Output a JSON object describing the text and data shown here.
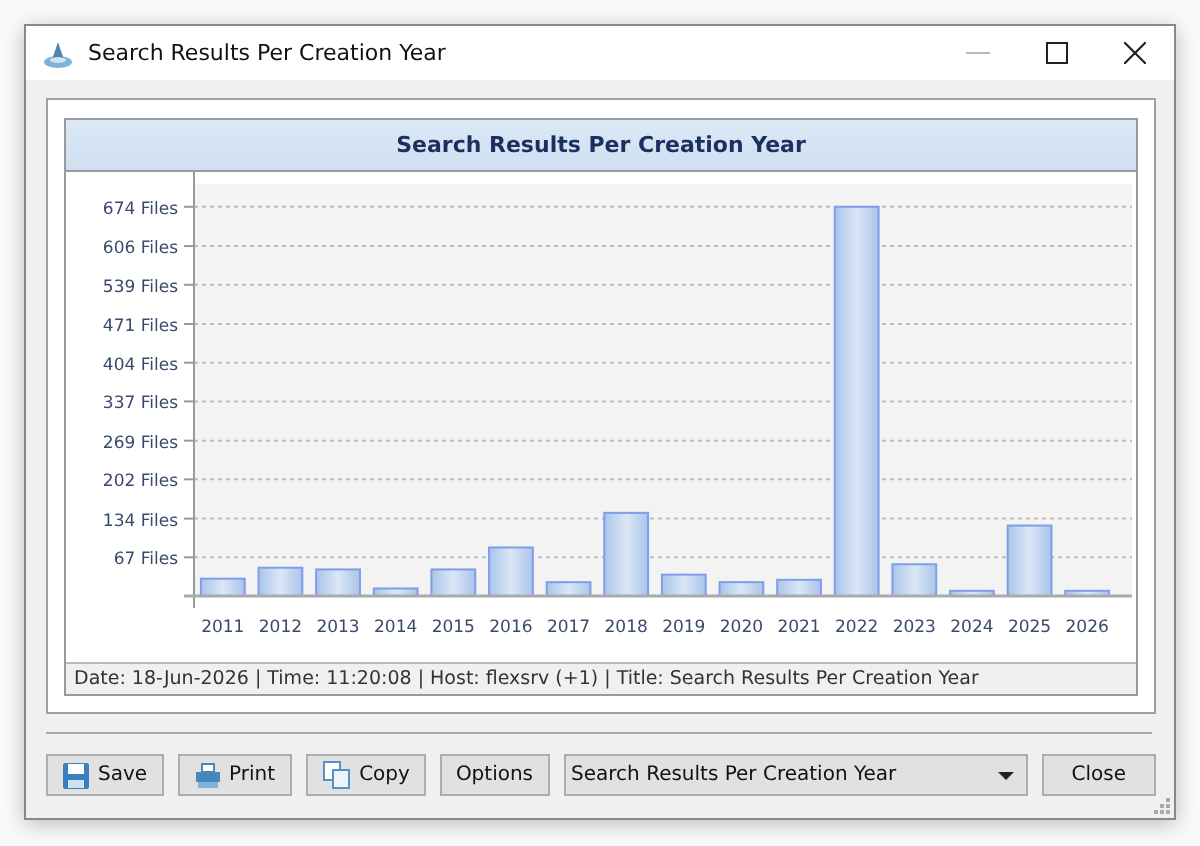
{
  "window": {
    "title": "Search Results Per Creation Year"
  },
  "chart_panel": {
    "header": "Search Results Per Creation Year",
    "chart_data": {
      "type": "bar",
      "categories": [
        "2011",
        "2012",
        "2013",
        "2014",
        "2015",
        "2016",
        "2017",
        "2018",
        "2019",
        "2020",
        "2021",
        "2022",
        "2023",
        "2024",
        "2025",
        "2026"
      ],
      "values": [
        30,
        49,
        46,
        13,
        46,
        84,
        24,
        144,
        37,
        24,
        28,
        674,
        55,
        9,
        122,
        9
      ],
      "ylim": [
        0,
        710
      ],
      "grid": true,
      "yticks": [
        {
          "value": 67,
          "label": "67 Files"
        },
        {
          "value": 134,
          "label": "134 Files"
        },
        {
          "value": 202,
          "label": "202 Files"
        },
        {
          "value": 269,
          "label": "269 Files"
        },
        {
          "value": 337,
          "label": "337 Files"
        },
        {
          "value": 404,
          "label": "404 Files"
        },
        {
          "value": 471,
          "label": "471 Files"
        },
        {
          "value": 539,
          "label": "539 Files"
        },
        {
          "value": 606,
          "label": "606 Files"
        },
        {
          "value": 674,
          "label": "674 Files"
        }
      ]
    },
    "status": "Date: 18-Jun-2026 | Time: 11:20:08 | Host: flexsrv (+1) | Title: Search Results Per Creation Year"
  },
  "buttons": [
    {
      "label": "Save",
      "kind": "save"
    },
    {
      "label": "Print",
      "kind": "print"
    },
    {
      "label": "Copy",
      "kind": "copy"
    },
    {
      "label": "Options",
      "kind": "plain"
    }
  ],
  "report_select": {
    "value": "Search Results Per Creation Year"
  },
  "close_button": "Close"
}
